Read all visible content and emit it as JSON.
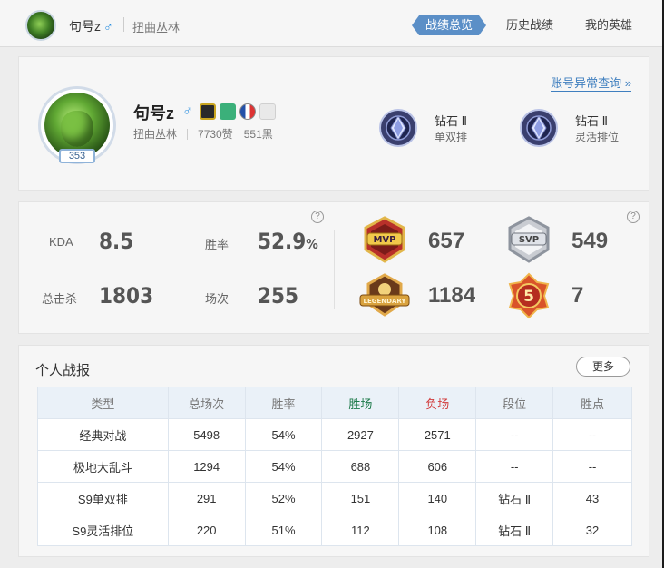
{
  "topbar": {
    "name": "句号z",
    "gender_symbol": "♂",
    "server": "扭曲丛林",
    "tabs": [
      {
        "label": "战绩总览",
        "active": true
      },
      {
        "label": "历史战绩",
        "active": false
      },
      {
        "label": "我的英雄",
        "active": false
      }
    ]
  },
  "profile": {
    "abnormal_link": "账号异常查询 »",
    "level": "353",
    "name": "句号z",
    "gender_symbol": "♂",
    "server": "扭曲丛林",
    "likes": "7730赞",
    "blacks": "551黑",
    "ranks": [
      {
        "tier": "钻石 Ⅱ",
        "queue": "单双排"
      },
      {
        "tier": "钻石 Ⅱ",
        "queue": "灵活排位"
      }
    ]
  },
  "stats": {
    "kda_label": "KDA",
    "kda": "8.5",
    "winrate_label": "胜率",
    "winrate": "52.9",
    "winrate_unit": "%",
    "kills_label": "总击杀",
    "kills": "1803",
    "games_label": "场次",
    "games": "255",
    "help": "?",
    "badges": [
      {
        "icon": "mvp-badge-icon",
        "text": "MVP",
        "value": "657"
      },
      {
        "icon": "svp-badge-icon",
        "text": "SVP",
        "value": "549"
      },
      {
        "icon": "legendary-badge-icon",
        "text": "LEGENDARY",
        "value": "1184"
      },
      {
        "icon": "pentakill-badge-icon",
        "text": "5",
        "value": "7"
      }
    ]
  },
  "record": {
    "title": "个人战报",
    "more": "更多",
    "headers": [
      "类型",
      "总场次",
      "胜率",
      "胜场",
      "负场",
      "段位",
      "胜点"
    ],
    "rows": [
      [
        "经典对战",
        "5498",
        "54%",
        "2927",
        "2571",
        "--",
        "--"
      ],
      [
        "极地大乱斗",
        "1294",
        "54%",
        "688",
        "606",
        "--",
        "--"
      ],
      [
        "S9单双排",
        "291",
        "52%",
        "151",
        "140",
        "钻石 Ⅱ",
        "43"
      ],
      [
        "S9灵活排位",
        "220",
        "51%",
        "112",
        "108",
        "钻石 Ⅱ",
        "32"
      ]
    ]
  },
  "colors": {
    "accent": "#5b8fc7",
    "link": "#3f7fbf",
    "win": "#1d7a4a",
    "lose": "#d23b3b"
  }
}
